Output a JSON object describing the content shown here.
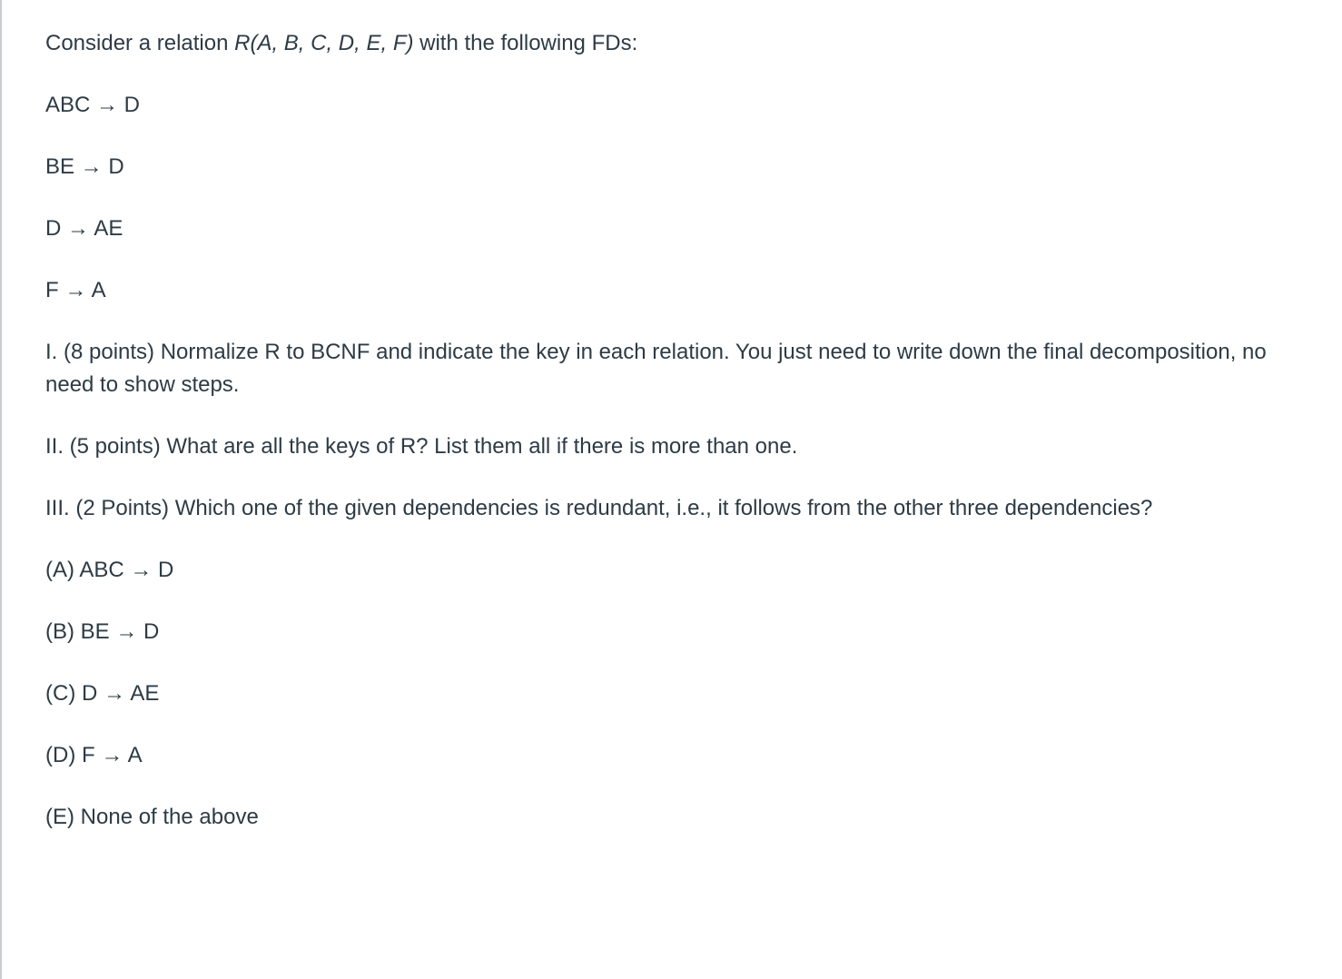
{
  "intro": {
    "prefix": "Consider a relation ",
    "relation": "R(A, B, C, D, E, F)",
    "suffix": " with the following FDs:"
  },
  "fds": [
    "ABC → D",
    "BE → D",
    "D → AE",
    "F → A"
  ],
  "parts": {
    "p1": "I.  (8 points) Normalize R to BCNF and indicate the key in each relation. You just need to write down the final decomposition, no need to show steps.",
    "p2": "II.  (5 points) What are all the keys of R? List them all if there is more than one.",
    "p3": "III. (2 Points) Which one of the given dependencies is redundant, i.e., it follows from the other three dependencies?"
  },
  "choices": [
    "(A)  ABC → D",
    "(B)  BE → D",
    "(C)  D → AE",
    "(D) F → A",
    "(E)  None of the above"
  ]
}
